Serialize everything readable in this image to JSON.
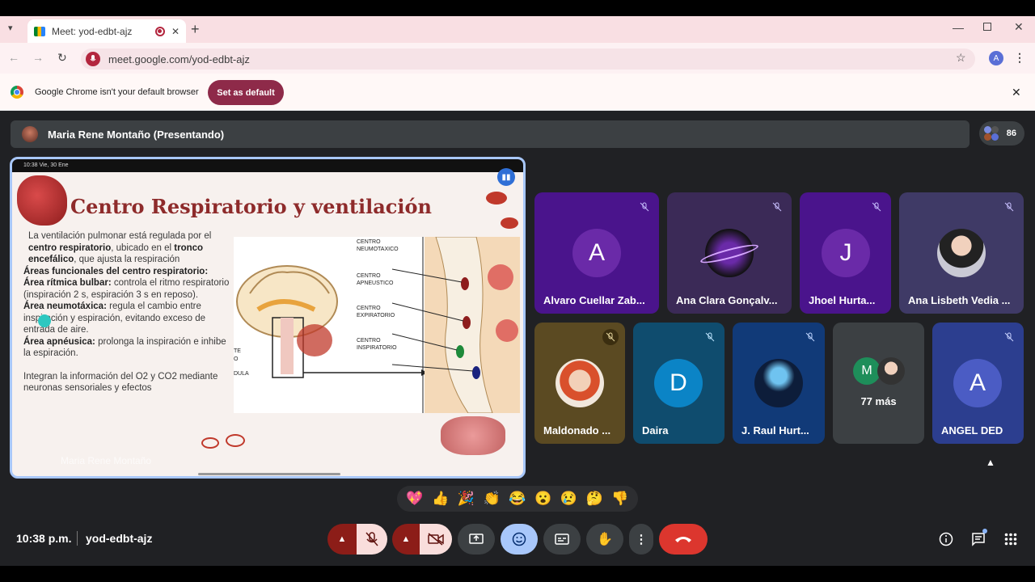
{
  "browser": {
    "tab_title": "Meet: yod-edbt-ajz",
    "url": "meet.google.com/yod-edbt-ajz",
    "profile_initial": "A",
    "infobar_text": "Google Chrome isn't your default browser",
    "set_default_label": "Set as default"
  },
  "meet": {
    "presenter_banner": "Maria Rene Montaño (Presentando)",
    "participant_count": "86",
    "presenter_tile_name": "Maria Rene Montaño",
    "clock": "10:38 p.m.",
    "meeting_code": "yod-edbt-ajz",
    "more_count": "77 más",
    "more_initial": "M"
  },
  "slide": {
    "status_time": "10:38  Vie, 30 Ene",
    "title": "Centro Respiratorio y ventilación",
    "para1": "La ventilación pulmonar está regulada por el",
    "para1_b1": "centro respiratorio",
    "para1_b": ", ubicado en el",
    "para1_b2": "tronco encefálico",
    "para1_c": ", que ajusta la respiración",
    "areas_heading": "Áreas funcionales del centro respiratorio:",
    "area1_label": "Área rítmica bulbar:",
    "area1_text": "controla el ritmo respiratorio (inspiración 2 s, espiración 3 s en reposo).",
    "area2_label": "Área neumotáxica:",
    "area2_text": "regula el cambio entre inspiración y espiración, evitando exceso de entrada de aire.",
    "area3_label": "Área apnéusica:",
    "area3_text": "prolonga la inspiración e inhibe la espiración.",
    "footer_text": "Integran la información del O2 y CO2 mediante neuronas sensoriales y efectos",
    "diagram_labels": [
      "CENTRO NEUMOTAXICO",
      "CENTRO APNEUSTICO",
      "CENTRO EXPIRATORIO",
      "CENTRO INSPIRATORIO"
    ],
    "diagram_left_labels": [
      "TE",
      "O",
      "DULA"
    ]
  },
  "tiles": [
    {
      "name": "Alvaro Cuellar Zab...",
      "initial": "A",
      "bg": "#4a148c",
      "av": "#6a2aa8"
    },
    {
      "name": "Ana Clara Gonçalv...",
      "initial": "",
      "bg": "#3b2a57",
      "av": "#1a1a2e"
    },
    {
      "name": "Jhoel Hurta...",
      "initial": "J",
      "bg": "#4a148c",
      "av": "#6a2aa8"
    },
    {
      "name": "Ana Lisbeth Vedia ...",
      "initial": "",
      "bg": "#3f3a66",
      "av": "#d6d6e0"
    },
    {
      "name": "Maldonado ...",
      "initial": "",
      "bg": "#5b4a22",
      "av": "#f1e7dc"
    },
    {
      "name": "Daira",
      "initial": "D",
      "bg": "#0f4c6e",
      "av": "#0b84c6"
    },
    {
      "name": "J. Raul Hurt...",
      "initial": "",
      "bg": "#113a78",
      "av": "#0d1d3a"
    },
    {
      "name": "ANGEL DED",
      "initial": "A",
      "bg": "#2c3e8f",
      "av": "#4b5cc4"
    }
  ],
  "reactions": [
    "💖",
    "👍",
    "🎉",
    "👏",
    "😂",
    "😮",
    "😢",
    "🤔",
    "👎"
  ],
  "colors": {
    "accent": "#a8c7fa",
    "end_call": "#dc362e",
    "muted_red": "#f9dedc",
    "muted_dark": "#8c1d18"
  }
}
